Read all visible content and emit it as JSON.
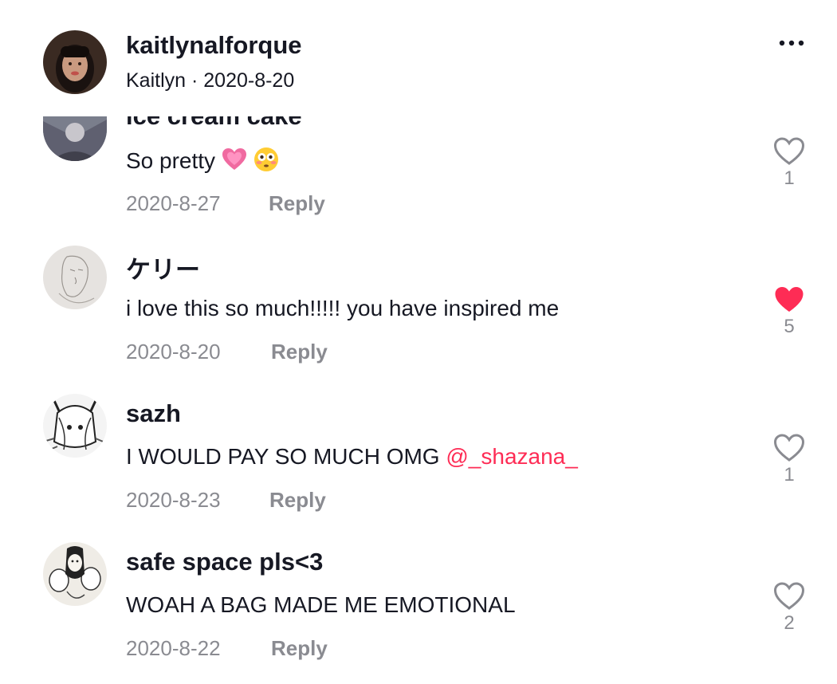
{
  "header": {
    "username": "kaitlynalforque",
    "display_name": "Kaitlyn",
    "separator": " · ",
    "date": "2020-8-20",
    "more_icon": "more-horizontal-icon"
  },
  "partial_comment": {
    "cut_username": "ice cream cake",
    "text": "So pretty",
    "emojis": [
      "growing-heart-emoji",
      "flushed-face-emoji"
    ],
    "date": "2020-8-27",
    "reply_label": "Reply",
    "likes": "1",
    "liked": false
  },
  "comments": [
    {
      "username": "ケリー",
      "text": "i love this so much!!!!! you have inspired me",
      "date": "2020-8-20",
      "reply_label": "Reply",
      "likes": "5",
      "liked": true
    },
    {
      "username": "sazh",
      "text": "I WOULD PAY SO MUCH OMG ",
      "mention": "@_shazana_",
      "date": "2020-8-23",
      "reply_label": "Reply",
      "likes": "1",
      "liked": false
    },
    {
      "username": "safe space pls<3",
      "text": "WOAH A BAG MADE ME EMOTIONAL",
      "date": "2020-8-22",
      "reply_label": "Reply",
      "likes": "2",
      "liked": false
    }
  ],
  "colors": {
    "text": "#161823",
    "muted": "#8a8b91",
    "accent": "#fe2c55"
  }
}
